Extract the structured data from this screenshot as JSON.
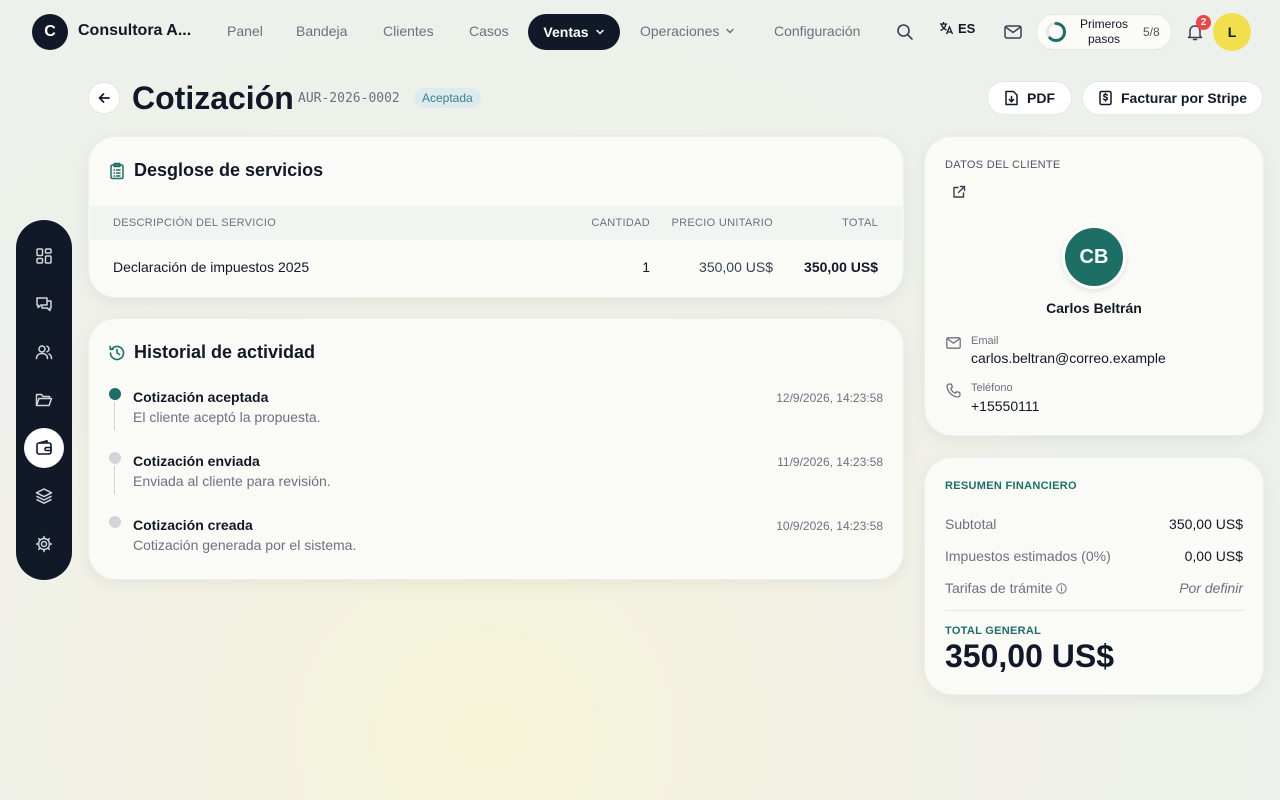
{
  "brand": {
    "initial": "C",
    "name": "Consultora A..."
  },
  "nav": {
    "items": [
      "Panel",
      "Bandeja",
      "Clientes",
      "Casos"
    ],
    "active": "Ventas",
    "operations": "Operaciones",
    "settings": "Configuración"
  },
  "topbar": {
    "language": "ES",
    "onboarding_label": "Primeros pasos",
    "onboarding_count": "5/8",
    "onboarding_progress": 0.625,
    "notifications_count": "2",
    "user_initial": "L"
  },
  "header": {
    "title": "Cotización",
    "quote_id": "AUR-2026-0002",
    "status": "Aceptada",
    "pdf_label": "PDF",
    "invoice_label": "Facturar por Stripe"
  },
  "services": {
    "title": "Desglose de servicios",
    "columns": [
      "DESCRIPCIÓN DEL SERVICIO",
      "CANTIDAD",
      "PRECIO UNITARIO",
      "TOTAL"
    ],
    "rows": [
      {
        "description": "Declaración de impuestos 2025",
        "quantity": "1",
        "unit_price": "350,00 US$",
        "total": "350,00 US$"
      }
    ]
  },
  "activity": {
    "title": "Historial de actividad",
    "events": [
      {
        "title": "Cotización aceptada",
        "description": "El cliente aceptó la propuesta.",
        "date": "12/9/2026, 14:23:58"
      },
      {
        "title": "Cotización enviada",
        "description": "Enviada al cliente para revisión.",
        "date": "11/9/2026, 14:23:58"
      },
      {
        "title": "Cotización creada",
        "description": "Cotización generada por el sistema.",
        "date": "10/9/2026, 14:23:58"
      }
    ]
  },
  "client": {
    "section_label": "DATOS DEL CLIENTE",
    "initials": "CB",
    "name": "Carlos Beltrán",
    "email_label": "Email",
    "email": "carlos.beltran@correo.example",
    "phone_label": "Teléfono",
    "phone": "+15550111"
  },
  "finance": {
    "section_label": "RESUMEN FINANCIERO",
    "subtotal_label": "Subtotal",
    "subtotal": "350,00 US$",
    "tax_label": "Impuestos estimados (0%)",
    "tax": "0,00 US$",
    "fees_label": "Tarifas de trámite",
    "fees": "Por definir",
    "total_label": "TOTAL GENERAL",
    "total": "350,00 US$"
  },
  "colors": {
    "accent": "#1d6f66",
    "dark": "#111827",
    "badge_bg": "#dcecee",
    "notification": "#ef4444",
    "avatar": "#f1e04c"
  }
}
